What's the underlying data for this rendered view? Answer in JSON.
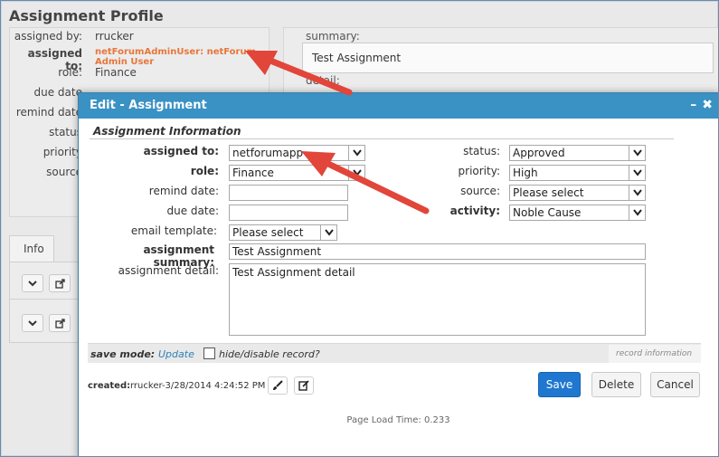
{
  "page": {
    "title": "Assignment Profile",
    "left_fields": [
      {
        "label": "assigned by:",
        "value": "rrucker"
      },
      {
        "label": "assigned to:",
        "value": "netForumAdminUser: netForum Admin User"
      },
      {
        "label": "role:",
        "value": "Finance"
      },
      {
        "label": "due date",
        "value": ""
      },
      {
        "label": "remind date",
        "value": ""
      },
      {
        "label": "status",
        "value": ""
      },
      {
        "label": "priority",
        "value": ""
      },
      {
        "label": "source",
        "value": ""
      }
    ],
    "summary_label": "summary:",
    "summary_value": "Test Assignment",
    "detail_label": "detail:",
    "tab_info": "Info"
  },
  "dialog": {
    "title": "Edit - Assignment",
    "section_title": "Assignment Information",
    "assigned_to": {
      "label": "assigned to:",
      "value": "netforumapp"
    },
    "role": {
      "label": "role:",
      "value": "Finance"
    },
    "remind_date": {
      "label": "remind date:",
      "value": ""
    },
    "due_date": {
      "label": "due date:",
      "value": ""
    },
    "email_template": {
      "label": "email template:",
      "value": "Please select"
    },
    "assignment_summary": {
      "label": "assignment summary:",
      "value": "Test Assignment"
    },
    "assignment_detail": {
      "label": "assignment detail:",
      "value": "Test Assignment detail"
    },
    "status": {
      "label": "status:",
      "value": "Approved"
    },
    "priority": {
      "label": "priority:",
      "value": "High"
    },
    "source": {
      "label": "source:",
      "value": "Please select"
    },
    "activity": {
      "label": "activity:",
      "value": "Noble Cause"
    },
    "save_mode_label": "save mode:",
    "save_mode_link": "Update",
    "hide_label": "hide/disable record?",
    "record_info": "record information",
    "created_label": "created:",
    "created_value": "rrucker-3/28/2014 4:24:52 PM",
    "save_button": "Save",
    "delete_button": "Delete",
    "cancel_button": "Cancel",
    "page_load_time": "Page Load Time: 0.233"
  },
  "colors": {
    "titlebar": "#3a91c4",
    "assigned_to_value": "#e8763a",
    "arrow": "#e2453a",
    "primary_button": "#1f77d0"
  }
}
